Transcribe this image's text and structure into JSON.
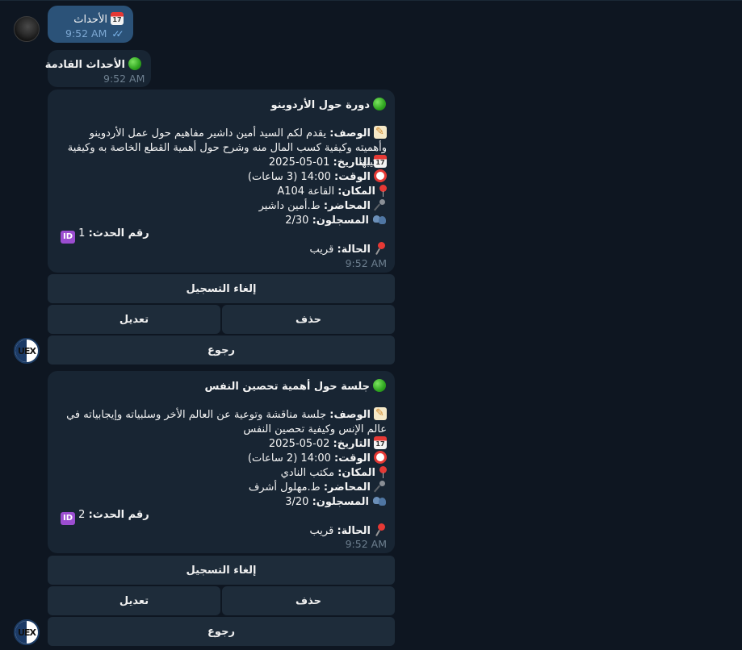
{
  "outgoing": {
    "text": "الأحداث",
    "time": "9:52 AM"
  },
  "header_message": {
    "text": "الأحداث القادمة",
    "time": "9:52 AM"
  },
  "events": [
    {
      "title": "دورة حول الأردوينو",
      "description_label": "الوصف:",
      "description": "يقدم لكم السيد أمين داشير مفاهيم حول عمل الأردوينو وأهميته وكيفية كسب المال منه وشرح حول أهمية القطع الخاصة به وكيفية تركيبها",
      "date_label": "التاريخ:",
      "date": "2025-05-01",
      "time_label": "الوقت:",
      "time": "14:00 (3 ساعات)",
      "place_label": "المكان:",
      "place": "القاعة A104",
      "speaker_label": "المحاضر:",
      "speaker": "ط.أمين داشير",
      "registered_label": "المسجلون:",
      "registered": "2/30",
      "id_label": "رقم الحدث:",
      "id": "1",
      "status_label": "الحالة:",
      "status": "قريب",
      "msg_time": "9:52 AM",
      "buttons": {
        "cancel": "إلغاء التسجيل",
        "delete": "حذف",
        "edit": "تعديل",
        "back": "رجوع"
      }
    },
    {
      "title": "جلسة حول أهمية تحصين النفس",
      "description_label": "الوصف:",
      "description": "جلسة مناقشة وتوعية عن العالم الأخر وسلبياته وإيجابياته في عالم الإنس وكيفية تحصين النفس",
      "date_label": "التاريخ:",
      "date": "2025-05-02",
      "time_label": "الوقت:",
      "time": "14:00 (2 ساعات)",
      "place_label": "المكان:",
      "place": "مكتب النادي",
      "speaker_label": "المحاضر:",
      "speaker": "ط.مهلول أشرف",
      "registered_label": "المسجلون:",
      "registered": "3/20",
      "id_label": "رقم الحدث:",
      "id": "2",
      "status_label": "الحالة:",
      "status": "قريب",
      "msg_time": "9:52 AM",
      "buttons": {
        "cancel": "إلغاء التسجيل",
        "delete": "حذف",
        "edit": "تعديل",
        "back": "رجوع"
      }
    }
  ],
  "bot_avatar_text": "UEX",
  "icons": [
    "calendar-icon",
    "green-circle-icon",
    "memo-icon",
    "alarm-clock-icon",
    "round-pin-icon",
    "microphone-icon",
    "people-icon",
    "id-icon",
    "pushpin-icon",
    "double-check-icon"
  ],
  "colors": {
    "background": "#0e1621",
    "bubble_in": "#182533",
    "bubble_out": "#2b5278",
    "button": "#1e2c3a",
    "meta": "#6d7f8f"
  }
}
